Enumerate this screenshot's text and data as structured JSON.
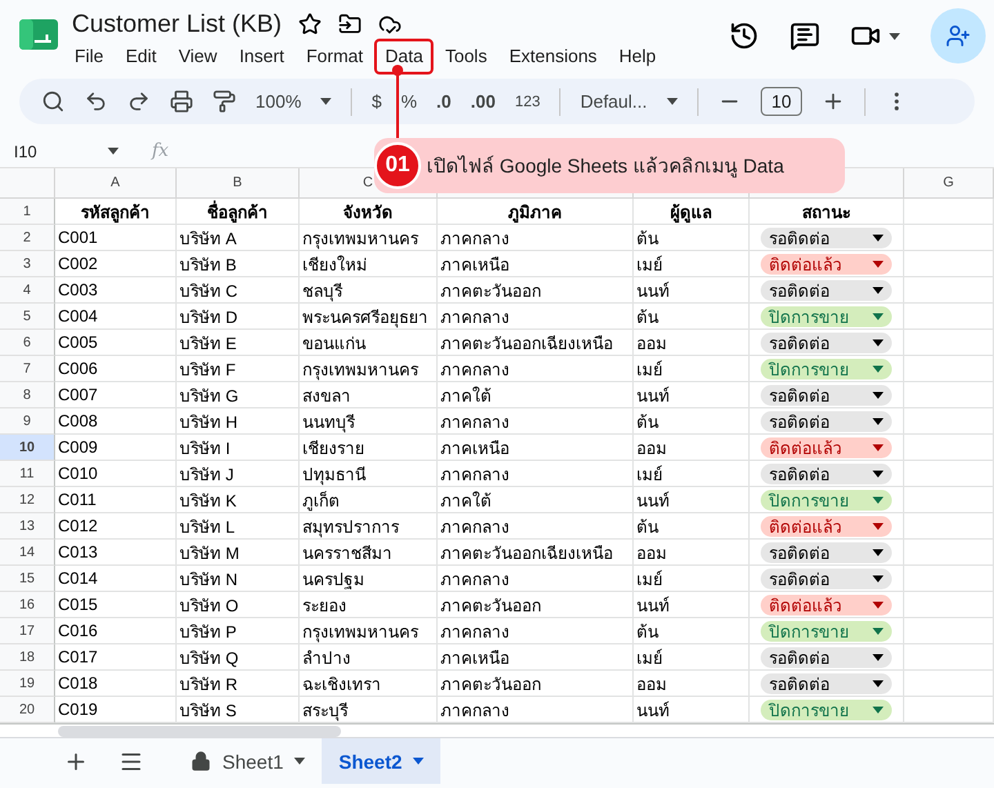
{
  "document": {
    "title": "Customer List (KB)"
  },
  "menu": [
    {
      "label": "File",
      "highlighted": false
    },
    {
      "label": "Edit",
      "highlighted": false
    },
    {
      "label": "View",
      "highlighted": false
    },
    {
      "label": "Insert",
      "highlighted": false
    },
    {
      "label": "Format",
      "highlighted": false
    },
    {
      "label": "Data",
      "highlighted": true
    },
    {
      "label": "Tools",
      "highlighted": false
    },
    {
      "label": "Extensions",
      "highlighted": false
    },
    {
      "label": "Help",
      "highlighted": false
    }
  ],
  "toolbar": {
    "zoom": "100%",
    "currency": "$",
    "percent": "%",
    "decrease_decimals": ".0",
    "increase_decimals": ".00",
    "number_format": "123",
    "font": "Defaul...",
    "font_size": "10"
  },
  "formula_bar": {
    "cell_ref": "I10",
    "fx": "fx"
  },
  "annotation": {
    "number": "01",
    "text": "เปิดไฟล์ Google Sheets แล้วคลิกเมนู Data"
  },
  "sheet": {
    "columns": [
      {
        "label": "A"
      },
      {
        "label": "B"
      },
      {
        "label": "C"
      },
      {},
      {},
      {},
      {
        "label": "G"
      }
    ],
    "header": {
      "number": "1",
      "cells": [
        "รหัสลูกค้า",
        "ชื่อลูกค้า",
        "จังหวัด",
        "ภูมิภาค",
        "ผู้ดูแล",
        "สถานะ"
      ]
    },
    "rows": [
      {
        "number": "2",
        "selected": false,
        "cells": [
          "C001",
          "บริษัท A",
          "กรุงเทพมหานคร",
          "ภาคกลาง",
          "ต้น"
        ],
        "status": {
          "label": "รอติดต่อ",
          "kind": "pending"
        }
      },
      {
        "number": "3",
        "selected": false,
        "cells": [
          "C002",
          "บริษัท B",
          "เชียงใหม่",
          "ภาคเหนือ",
          "เมย์"
        ],
        "status": {
          "label": "ติดต่อแล้ว",
          "kind": "contacted"
        }
      },
      {
        "number": "4",
        "selected": false,
        "cells": [
          "C003",
          "บริษัท C",
          "ชลบุรี",
          "ภาคตะวันออก",
          "นนท์"
        ],
        "status": {
          "label": "รอติดต่อ",
          "kind": "pending"
        }
      },
      {
        "number": "5",
        "selected": false,
        "cells": [
          "C004",
          "บริษัท D",
          "พระนครศรีอยุธยา",
          "ภาคกลาง",
          "ต้น"
        ],
        "status": {
          "label": "ปิดการขาย",
          "kind": "closed"
        }
      },
      {
        "number": "6",
        "selected": false,
        "cells": [
          "C005",
          "บริษัท E",
          "ขอนแก่น",
          "ภาคตะวันออกเฉียงเหนือ",
          "ออม"
        ],
        "status": {
          "label": "รอติดต่อ",
          "kind": "pending"
        }
      },
      {
        "number": "7",
        "selected": false,
        "cells": [
          "C006",
          "บริษัท F",
          "กรุงเทพมหานคร",
          "ภาคกลาง",
          "เมย์"
        ],
        "status": {
          "label": "ปิดการขาย",
          "kind": "closed"
        }
      },
      {
        "number": "8",
        "selected": false,
        "cells": [
          "C007",
          "บริษัท G",
          "สงขลา",
          "ภาคใต้",
          "นนท์"
        ],
        "status": {
          "label": "รอติดต่อ",
          "kind": "pending"
        }
      },
      {
        "number": "9",
        "selected": false,
        "cells": [
          "C008",
          "บริษัท H",
          "นนทบุรี",
          "ภาคกลาง",
          "ต้น"
        ],
        "status": {
          "label": "รอติดต่อ",
          "kind": "pending"
        }
      },
      {
        "number": "10",
        "selected": true,
        "cells": [
          "C009",
          "บริษัท I",
          "เชียงราย",
          "ภาคเหนือ",
          "ออม"
        ],
        "status": {
          "label": "ติดต่อแล้ว",
          "kind": "contacted"
        }
      },
      {
        "number": "11",
        "selected": false,
        "cells": [
          "C010",
          "บริษัท J",
          "ปทุมธานี",
          "ภาคกลาง",
          "เมย์"
        ],
        "status": {
          "label": "รอติดต่อ",
          "kind": "pending"
        }
      },
      {
        "number": "12",
        "selected": false,
        "cells": [
          "C011",
          "บริษัท K",
          "ภูเก็ต",
          "ภาคใต้",
          "นนท์"
        ],
        "status": {
          "label": "ปิดการขาย",
          "kind": "closed"
        }
      },
      {
        "number": "13",
        "selected": false,
        "cells": [
          "C012",
          "บริษัท L",
          "สมุทรปราการ",
          "ภาคกลาง",
          "ต้น"
        ],
        "status": {
          "label": "ติดต่อแล้ว",
          "kind": "contacted"
        }
      },
      {
        "number": "14",
        "selected": false,
        "cells": [
          "C013",
          "บริษัท M",
          "นครราชสีมา",
          "ภาคตะวันออกเฉียงเหนือ",
          "ออม"
        ],
        "status": {
          "label": "รอติดต่อ",
          "kind": "pending"
        }
      },
      {
        "number": "15",
        "selected": false,
        "cells": [
          "C014",
          "บริษัท N",
          "นครปฐม",
          "ภาคกลาง",
          "เมย์"
        ],
        "status": {
          "label": "รอติดต่อ",
          "kind": "pending"
        }
      },
      {
        "number": "16",
        "selected": false,
        "cells": [
          "C015",
          "บริษัท O",
          "ระยอง",
          "ภาคตะวันออก",
          "นนท์"
        ],
        "status": {
          "label": "ติดต่อแล้ว",
          "kind": "contacted"
        }
      },
      {
        "number": "17",
        "selected": false,
        "cells": [
          "C016",
          "บริษัท P",
          "กรุงเทพมหานคร",
          "ภาคกลาง",
          "ต้น"
        ],
        "status": {
          "label": "ปิดการขาย",
          "kind": "closed"
        }
      },
      {
        "number": "18",
        "selected": false,
        "cells": [
          "C017",
          "บริษัท Q",
          "ลำปาง",
          "ภาคเหนือ",
          "เมย์"
        ],
        "status": {
          "label": "รอติดต่อ",
          "kind": "pending"
        }
      },
      {
        "number": "19",
        "selected": false,
        "cells": [
          "C018",
          "บริษัท R",
          "ฉะเชิงเทรา",
          "ภาคตะวันออก",
          "ออม"
        ],
        "status": {
          "label": "รอติดต่อ",
          "kind": "pending"
        }
      },
      {
        "number": "20",
        "selected": false,
        "cells": [
          "C019",
          "บริษัท S",
          "สระบุรี",
          "ภาคกลาง",
          "นนท์"
        ],
        "status": {
          "label": "ปิดการขาย",
          "kind": "closed"
        }
      }
    ]
  },
  "sheet_tabs": [
    {
      "label": "Sheet1",
      "locked": true,
      "selected": false
    },
    {
      "label": "Sheet2",
      "locked": false,
      "selected": true
    }
  ]
}
